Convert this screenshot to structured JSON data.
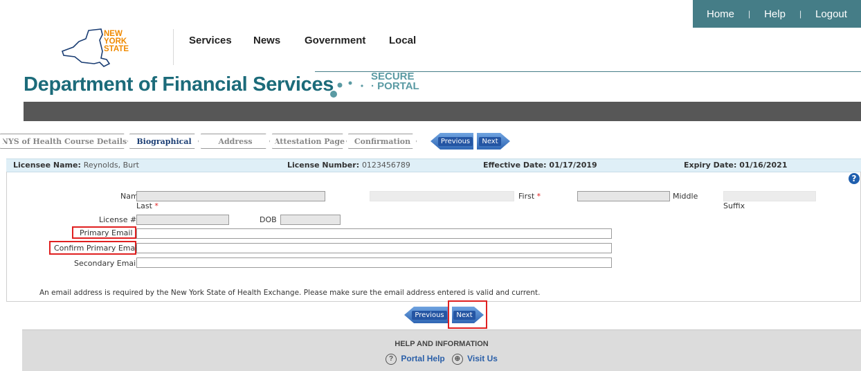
{
  "topbar": {
    "home": "Home",
    "sep": "|",
    "help": "Help",
    "logout": "Logout"
  },
  "logo": {
    "line1": "NEW",
    "line2": "YORK",
    "line3": "STATE"
  },
  "nav": {
    "services": "Services",
    "news": "News",
    "government": "Government",
    "local": "Local"
  },
  "header": {
    "title": "Department of Financial Services",
    "secure_line1": "SECURE",
    "secure_line2": "PORTAL"
  },
  "steps": {
    "course": "NYS of Health Course Details",
    "bio": "Biographical",
    "address": "Address",
    "attestation": "Attestation Page",
    "confirmation": "Confirmation"
  },
  "buttons": {
    "previous": "Previous",
    "next": "Next"
  },
  "licensee": {
    "name_label": "Licensee Name:",
    "name_value": "Reynolds, Burt",
    "number_label": "License Number:",
    "number_value": "0123456789",
    "effective_label": "Effective Date:",
    "effective_value": "01/17/2019",
    "expiry_label": "Expiry Date:",
    "expiry_value": "01/16/2021"
  },
  "form": {
    "name_label": "Name",
    "last_label": "Last",
    "first_label": "First",
    "middle_label": "Middle",
    "suffix_label": "Suffix",
    "license_label": "License #",
    "dob_label": "DOB",
    "primary_email_label": "Primary Email",
    "confirm_email_label": "Confirm Primary Email",
    "secondary_email_label": "Secondary Email",
    "required_mark": "*",
    "note": "An email address is required by the New York State of Health Exchange. Please make sure the email address entered is valid and current."
  },
  "help_icon": "?",
  "footer": {
    "title": "HELP AND INFORMATION",
    "portal_help": "Portal Help",
    "visit_us": "Visit Us"
  },
  "colors": {
    "teal": "#457d87",
    "title_teal": "#1c6b7a",
    "required": "#e02020",
    "link_blue": "#2a5fa8"
  },
  "icons": {
    "help": "question-circle-icon",
    "globe": "globe-icon"
  }
}
